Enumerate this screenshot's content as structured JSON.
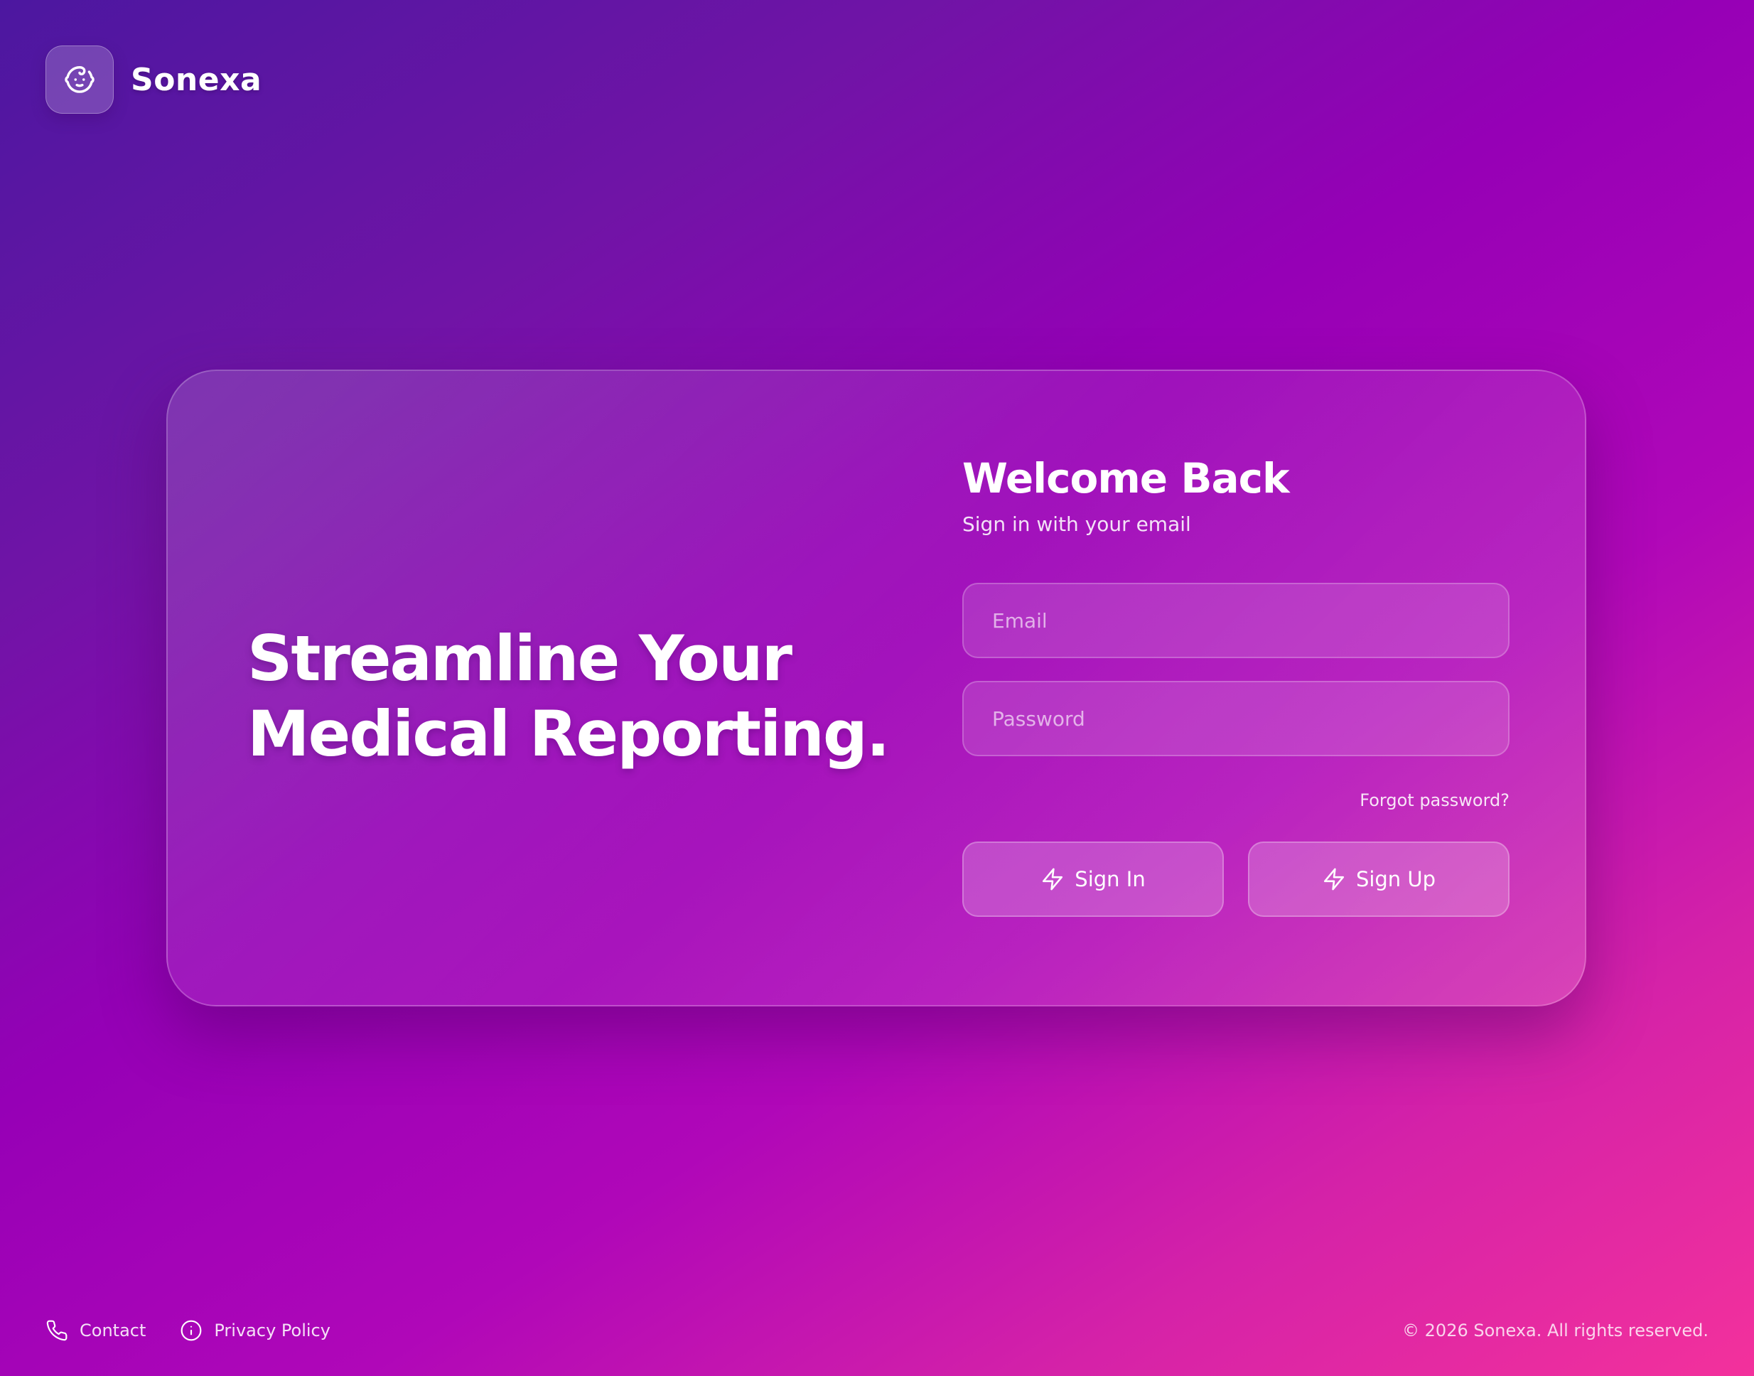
{
  "brand": {
    "name": "Sonexa",
    "logo_icon": "baby-face-icon"
  },
  "hero": {
    "headline_line1": "Streamline Your",
    "headline_line2": "Medical Reporting."
  },
  "login_form": {
    "title": "Welcome Back",
    "subtitle": "Sign in with your email",
    "email_placeholder": "Email",
    "password_placeholder": "Password",
    "forgot_password": "Forgot password?",
    "sign_in_label": "Sign In",
    "sign_up_label": "Sign Up",
    "button_icon": "lightning-icon"
  },
  "footer": {
    "links": [
      {
        "label": "Contact",
        "icon": "phone-icon"
      },
      {
        "label": "Privacy Policy",
        "icon": "info-icon"
      }
    ],
    "copyright": "© 2026 Sonexa. All rights reserved."
  },
  "colors": {
    "gradient_start": "#4c17a0",
    "gradient_mid": "#9600b6",
    "gradient_end": "#f3319c",
    "text": "#ffffff"
  }
}
